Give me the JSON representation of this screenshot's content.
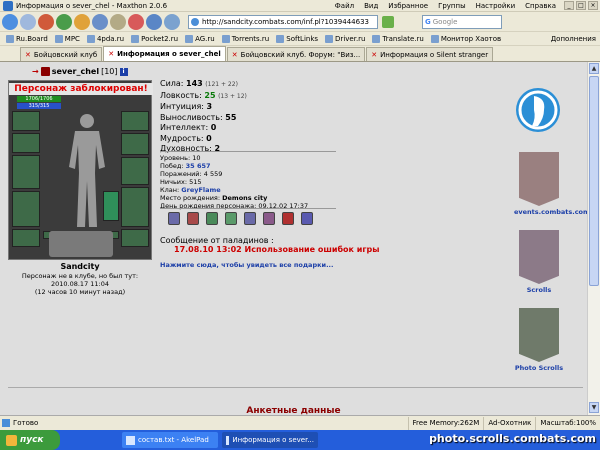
{
  "window": {
    "title": "Информация о sever_chel - Maxthon 2.0.6"
  },
  "menu": [
    "Файл",
    "Вид",
    "Избранное",
    "Группы",
    "Настройки",
    "Справка"
  ],
  "address": {
    "url": "http://sandcity.combats.com/inf.pl?1039444633"
  },
  "search": {
    "placeholder": "Google"
  },
  "links": [
    "Ru.Board",
    "MPC",
    "4pda.ru",
    "Pocket2.ru",
    "AG.ru",
    "Torrents.ru",
    "SoftLinks",
    "Driver.ru",
    "Translate.ru",
    "Монитор Хаотов"
  ],
  "links_extra": "Дополнения",
  "tabs": [
    {
      "label": "Бойцовский клуб",
      "active": false
    },
    {
      "label": "Информация о sever_chel",
      "active": true
    },
    {
      "label": "Бойцовский клуб. Форум: \"Виз...",
      "active": false
    },
    {
      "label": "Информация о Silent stranger",
      "active": false
    }
  ],
  "character": {
    "nick": "sever_chel",
    "level": "[10]",
    "blocked": "Персонаж заблокирован!",
    "hp": "1706/1706",
    "mp": "315/315",
    "city": "Sandcity",
    "status_line1": "Персонаж не в клубе, но был тут:",
    "status_line2": "2010.08.17 11:04",
    "status_line3": "(12 часов 10 минут назад)"
  },
  "stats": {
    "strength_label": "Сила:",
    "strength": "143",
    "strength_extra": "(121 + 22)",
    "agility_label": "Ловкость:",
    "agility": "25",
    "agility_extra": "(13 + 12)",
    "intuition_label": "Интуиция:",
    "intuition": "3",
    "endurance_label": "Выносливость:",
    "endurance": "55",
    "intellect_label": "Интеллект:",
    "intellect": "0",
    "wisdom_label": "Мудрость:",
    "wisdom": "0",
    "spirit_label": "Духовность:",
    "spirit": "2"
  },
  "info": {
    "level_line": "Уровень: 10",
    "wins_label": "Побед:",
    "wins": "35 657",
    "losses_line": "Поражений: 4 559",
    "draws_line": "Ничьих: 515",
    "clan_label": "Клан:",
    "clan": "GreyFlame",
    "birthplace_label": "Место рождения:",
    "birthplace": "Demons city",
    "birthday_line": "День рождения персонажа: 09.12.02 17:37"
  },
  "paladin": {
    "heading": "Сообщение от паладинов :",
    "message": "17.08.10 13:02 Использование ошибок игры"
  },
  "gifts_link": "Нажмите сюда, чтобы увидеть все подарки...",
  "sidebar": [
    {
      "label": "events.combats.com",
      "icon": "events-banner-icon"
    },
    {
      "label": "Scrolls",
      "icon": "scrolls-banner-icon"
    },
    {
      "label": "Photo Scrolls",
      "icon": "photo-scrolls-banner-icon"
    }
  ],
  "section_title": "Анкетные данные",
  "statusbar": {
    "ready": "Готово",
    "memory": "Free Memory:262M",
    "adblock": "Ad-Охотник",
    "zoom": "Масштаб:100%"
  },
  "taskbar": {
    "start": "пуск",
    "tasks": [
      "состав.txt - AkelPad",
      "Информация о sever..."
    ]
  },
  "watermark": "photo.scrolls.combats.com",
  "colors": {
    "blocked": "#dd0000",
    "link": "#1c3fa8",
    "paladin": "#cc0000",
    "title": "#8b0000"
  }
}
